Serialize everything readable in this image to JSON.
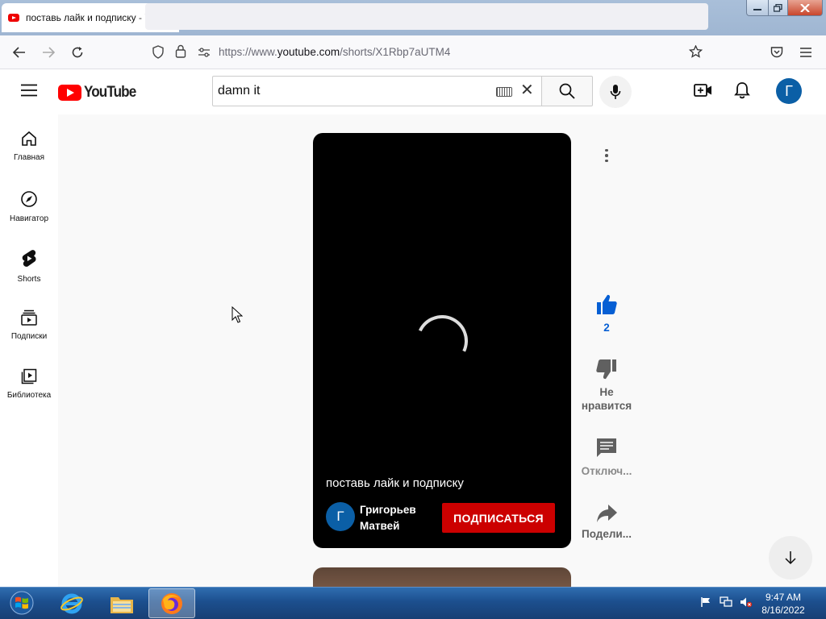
{
  "browser": {
    "tab_title": "поставь лайк и подписку - YouTube",
    "tab_close": "✕",
    "new_tab": "+",
    "url_prefix": "https://www.",
    "url_domain": "youtube.com",
    "url_path": "/shorts/X1Rbp7aUTM4"
  },
  "youtube": {
    "logo_text": "YouTube",
    "search_value": "damn it",
    "search_clear": "✕",
    "avatar_letter": "Г"
  },
  "sidebar": {
    "items": [
      {
        "label": "Главная",
        "icon": "home-icon"
      },
      {
        "label": "Навигатор",
        "icon": "compass-icon"
      },
      {
        "label": "Shorts",
        "icon": "shorts-icon"
      },
      {
        "label": "Подписки",
        "icon": "subscriptions-icon"
      },
      {
        "label": "Библиотека",
        "icon": "library-icon"
      }
    ]
  },
  "short": {
    "title": "поставь лайк и подписку",
    "channel_avatar_letter": "Г",
    "channel_name": "Григорьев Матвей",
    "subscribe_label": "ПОДПИСАТЬСЯ"
  },
  "actions": {
    "like_count": "2",
    "dislike_label": "Не нравится",
    "comments_label": "Отключ...",
    "share_label": "Подели..."
  },
  "taskbar": {
    "time": "9:47 AM",
    "date": "8/16/2022"
  },
  "colors": {
    "youtube_red": "#ff0000",
    "subscribe_red": "#cc0000",
    "like_blue": "#065fd4",
    "avatar_blue": "#0b5fa6"
  }
}
